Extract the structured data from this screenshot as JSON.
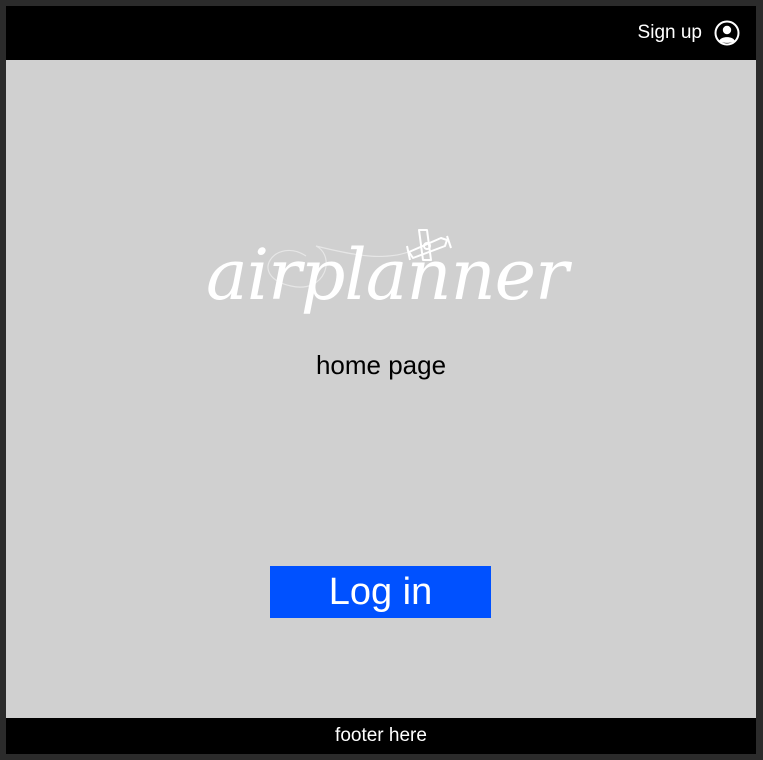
{
  "header": {
    "signup_label": "Sign up",
    "signup_icon": "user-circle-icon"
  },
  "logo": {
    "text": "airplanner",
    "icon": "biplane-icon"
  },
  "main": {
    "subtitle": "home page",
    "login_label": "Log in"
  },
  "footer": {
    "text": "footer here"
  },
  "colors": {
    "topbar": "#000000",
    "background": "#d0d0d0",
    "login_button": "#0051ff",
    "footer": "#000000",
    "logo": "#ffffff"
  }
}
